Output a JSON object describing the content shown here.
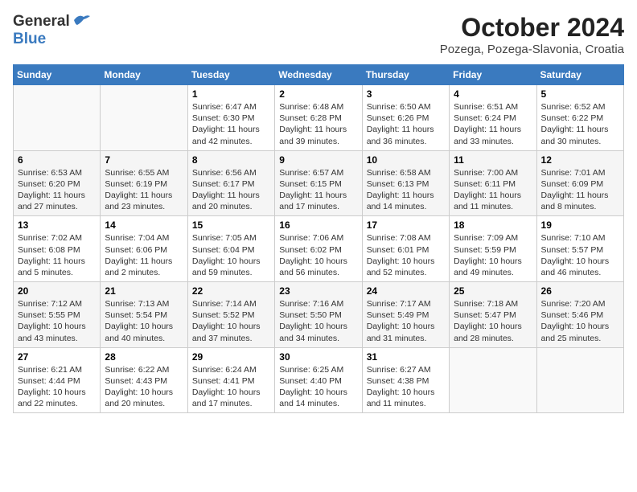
{
  "header": {
    "logo_general": "General",
    "logo_blue": "Blue",
    "month": "October 2024",
    "location": "Pozega, Pozega-Slavonia, Croatia"
  },
  "weekdays": [
    "Sunday",
    "Monday",
    "Tuesday",
    "Wednesday",
    "Thursday",
    "Friday",
    "Saturday"
  ],
  "weeks": [
    [
      {
        "day": "",
        "info": ""
      },
      {
        "day": "",
        "info": ""
      },
      {
        "day": "1",
        "info": "Sunrise: 6:47 AM\nSunset: 6:30 PM\nDaylight: 11 hours and 42 minutes."
      },
      {
        "day": "2",
        "info": "Sunrise: 6:48 AM\nSunset: 6:28 PM\nDaylight: 11 hours and 39 minutes."
      },
      {
        "day": "3",
        "info": "Sunrise: 6:50 AM\nSunset: 6:26 PM\nDaylight: 11 hours and 36 minutes."
      },
      {
        "day": "4",
        "info": "Sunrise: 6:51 AM\nSunset: 6:24 PM\nDaylight: 11 hours and 33 minutes."
      },
      {
        "day": "5",
        "info": "Sunrise: 6:52 AM\nSunset: 6:22 PM\nDaylight: 11 hours and 30 minutes."
      }
    ],
    [
      {
        "day": "6",
        "info": "Sunrise: 6:53 AM\nSunset: 6:20 PM\nDaylight: 11 hours and 27 minutes."
      },
      {
        "day": "7",
        "info": "Sunrise: 6:55 AM\nSunset: 6:19 PM\nDaylight: 11 hours and 23 minutes."
      },
      {
        "day": "8",
        "info": "Sunrise: 6:56 AM\nSunset: 6:17 PM\nDaylight: 11 hours and 20 minutes."
      },
      {
        "day": "9",
        "info": "Sunrise: 6:57 AM\nSunset: 6:15 PM\nDaylight: 11 hours and 17 minutes."
      },
      {
        "day": "10",
        "info": "Sunrise: 6:58 AM\nSunset: 6:13 PM\nDaylight: 11 hours and 14 minutes."
      },
      {
        "day": "11",
        "info": "Sunrise: 7:00 AM\nSunset: 6:11 PM\nDaylight: 11 hours and 11 minutes."
      },
      {
        "day": "12",
        "info": "Sunrise: 7:01 AM\nSunset: 6:09 PM\nDaylight: 11 hours and 8 minutes."
      }
    ],
    [
      {
        "day": "13",
        "info": "Sunrise: 7:02 AM\nSunset: 6:08 PM\nDaylight: 11 hours and 5 minutes."
      },
      {
        "day": "14",
        "info": "Sunrise: 7:04 AM\nSunset: 6:06 PM\nDaylight: 11 hours and 2 minutes."
      },
      {
        "day": "15",
        "info": "Sunrise: 7:05 AM\nSunset: 6:04 PM\nDaylight: 10 hours and 59 minutes."
      },
      {
        "day": "16",
        "info": "Sunrise: 7:06 AM\nSunset: 6:02 PM\nDaylight: 10 hours and 56 minutes."
      },
      {
        "day": "17",
        "info": "Sunrise: 7:08 AM\nSunset: 6:01 PM\nDaylight: 10 hours and 52 minutes."
      },
      {
        "day": "18",
        "info": "Sunrise: 7:09 AM\nSunset: 5:59 PM\nDaylight: 10 hours and 49 minutes."
      },
      {
        "day": "19",
        "info": "Sunrise: 7:10 AM\nSunset: 5:57 PM\nDaylight: 10 hours and 46 minutes."
      }
    ],
    [
      {
        "day": "20",
        "info": "Sunrise: 7:12 AM\nSunset: 5:55 PM\nDaylight: 10 hours and 43 minutes."
      },
      {
        "day": "21",
        "info": "Sunrise: 7:13 AM\nSunset: 5:54 PM\nDaylight: 10 hours and 40 minutes."
      },
      {
        "day": "22",
        "info": "Sunrise: 7:14 AM\nSunset: 5:52 PM\nDaylight: 10 hours and 37 minutes."
      },
      {
        "day": "23",
        "info": "Sunrise: 7:16 AM\nSunset: 5:50 PM\nDaylight: 10 hours and 34 minutes."
      },
      {
        "day": "24",
        "info": "Sunrise: 7:17 AM\nSunset: 5:49 PM\nDaylight: 10 hours and 31 minutes."
      },
      {
        "day": "25",
        "info": "Sunrise: 7:18 AM\nSunset: 5:47 PM\nDaylight: 10 hours and 28 minutes."
      },
      {
        "day": "26",
        "info": "Sunrise: 7:20 AM\nSunset: 5:46 PM\nDaylight: 10 hours and 25 minutes."
      }
    ],
    [
      {
        "day": "27",
        "info": "Sunrise: 6:21 AM\nSunset: 4:44 PM\nDaylight: 10 hours and 22 minutes."
      },
      {
        "day": "28",
        "info": "Sunrise: 6:22 AM\nSunset: 4:43 PM\nDaylight: 10 hours and 20 minutes."
      },
      {
        "day": "29",
        "info": "Sunrise: 6:24 AM\nSunset: 4:41 PM\nDaylight: 10 hours and 17 minutes."
      },
      {
        "day": "30",
        "info": "Sunrise: 6:25 AM\nSunset: 4:40 PM\nDaylight: 10 hours and 14 minutes."
      },
      {
        "day": "31",
        "info": "Sunrise: 6:27 AM\nSunset: 4:38 PM\nDaylight: 10 hours and 11 minutes."
      },
      {
        "day": "",
        "info": ""
      },
      {
        "day": "",
        "info": ""
      }
    ]
  ]
}
